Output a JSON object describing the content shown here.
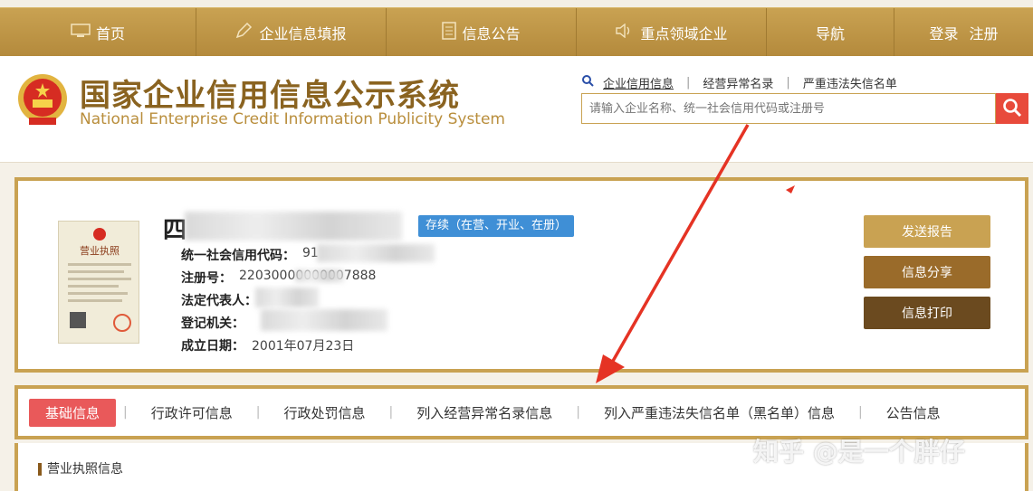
{
  "nav": {
    "home": "首页",
    "report": "企业信息填报",
    "notice": "信息公告",
    "key_sector": "重点领域企业",
    "guide": "导航",
    "login": "登录",
    "register": "注册"
  },
  "header": {
    "title_cn": "国家企业信用信息公示系统",
    "title_en": "National Enterprise Credit Information Publicity System",
    "search_tabs": [
      "企业信用信息",
      "经营异常名录",
      "严重违法失信名单"
    ],
    "search_placeholder": "请输入企业名称、统一社会信用代码或注册号"
  },
  "company": {
    "name_visible": "四",
    "status": "存续（在营、开业、在册）",
    "license_caption": "营业执照",
    "fields": [
      {
        "label": "统一社会信用代码：",
        "value": "91"
      },
      {
        "label": "注册号：",
        "value": "22030000000007888"
      },
      {
        "label": "法定代表人：",
        "value": ""
      },
      {
        "label": "登记机关：",
        "value": ""
      },
      {
        "label": "成立日期：",
        "value": "2001年07月23日"
      }
    ]
  },
  "actions": {
    "send_report": "发送报告",
    "share": "信息分享",
    "print": "信息打印"
  },
  "tabs": [
    "基础信息",
    "行政许可信息",
    "行政处罚信息",
    "列入经营异常名录信息",
    "列入严重违法失信名单（黑名单）信息",
    "公告信息"
  ],
  "section": {
    "title": "营业执照信息"
  },
  "watermark": "知乎 @是一个胖仔",
  "colors": {
    "gold": "#c9a252",
    "dark_gold": "#8a6320",
    "status_blue": "#3f8fd6",
    "active_tab": "#e9595a",
    "search_red": "#e84a3b",
    "btn_send": "#c9a252",
    "btn_share": "#9a6b2a",
    "btn_print": "#6b4a1f"
  }
}
